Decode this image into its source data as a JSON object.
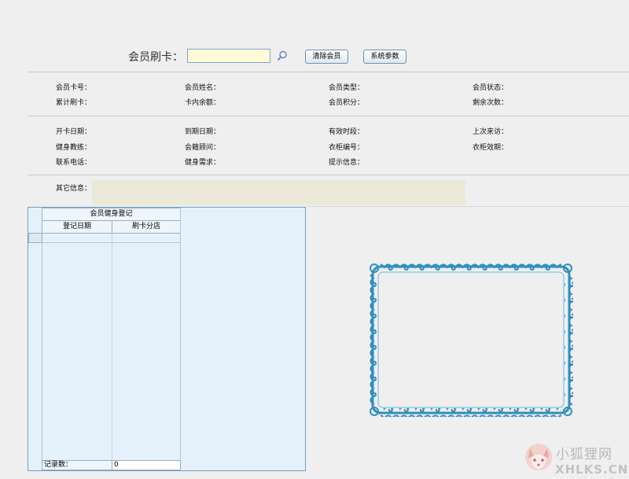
{
  "swipe": {
    "label": "会员刷卡：",
    "input_value": "",
    "clear_button": "清除会员",
    "params_button": "系统参数"
  },
  "member_fields": {
    "card_no": "会员卡号：",
    "name": "会员姓名：",
    "type": "会员类型：",
    "status": "会员状态：",
    "total_swipes": "累计刷卡：",
    "balance": "卡内余额：",
    "points": "会员积分：",
    "remaining_times": "剩余次数：",
    "open_date": "开卡日期：",
    "expire_date": "到期日期：",
    "valid_period": "有效时段：",
    "last_visit": "上次来访：",
    "coach": "健身教练：",
    "consultant": "会籍顾问：",
    "locker_no": "衣柜编号：",
    "locker_expire": "衣柜效期：",
    "phone": "联系电话：",
    "fitness_needs": "健身需求：",
    "notice": "提示信息：",
    "other_info": "其它信息："
  },
  "grid": {
    "group_header": "会员健身登记",
    "columns": [
      "登记日期",
      "刷卡分店"
    ],
    "record_count_label": "记录数：",
    "record_count": "0"
  },
  "watermark": {
    "name": "小狐狸网",
    "url": "XHLKS.CN"
  },
  "colors": {
    "background": "#efefef",
    "grid_bg": "#e4f1fb",
    "frame": "#2f8fbf",
    "input_bg": "#fffbd8",
    "other_info_bg": "#ede9d9"
  }
}
